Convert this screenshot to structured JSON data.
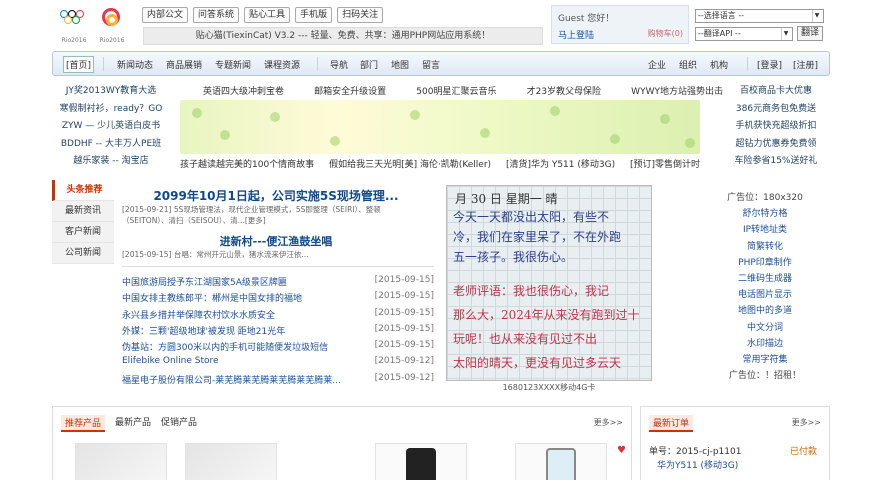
{
  "logos": [
    {
      "caption": "Rio2016"
    },
    {
      "caption": "Rio2016"
    }
  ],
  "top_buttons": [
    "内部公文",
    "问答系统",
    "贴心工具",
    "手机版",
    "扫码关注"
  ],
  "slogan": "贴心猫(TiexinCat) V3.2 --- 轻量、免费、共享：通用PHP网站应用系统！",
  "user": {
    "greeting": "Guest 您好！",
    "login": "马上登陆",
    "cart": "购物车(0)"
  },
  "language_select": "--选择语言 --",
  "translate_select": "--翻译API --",
  "translate_button": "翻译",
  "nav": {
    "home": "[首页]",
    "left": [
      "新闻动态",
      "商品展销",
      "专题新闻",
      "课程资源"
    ],
    "mid": [
      "导航",
      "部门",
      "地图",
      "留言"
    ],
    "right": [
      "企业",
      "组织",
      "机构"
    ],
    "auth": [
      "[登录]",
      "[注册]"
    ]
  },
  "ads_left": [
    "JY奖2013WY教育大选",
    "寒假制衬衫，ready？GO",
    "ZYW — 少儿英语白皮书",
    "BDDHF -- 大丰万人PE班",
    "越乐家装 -- 淘宝店"
  ],
  "ads_top": [
    "英语四大级冲刺宝卷",
    "邮箱安全升级设置",
    "500明星汇聚云音乐",
    "才23岁教父母保险",
    "WYWY地方站强势出击"
  ],
  "ads_bottom": [
    "孩子越读越完美的100个情商故事",
    "假如给我三天光明[美] 海伦·凯勒(Keller)",
    "[清货]华为 Y511 (移动3G)",
    "[预订]零售倒计时"
  ],
  "ads_right": [
    "百校商品卡大优惠",
    "386元商务包免费送",
    "手机获快充超级折扣",
    "超钻力优惠券免费领",
    "车险参省15%送好礼"
  ],
  "left_menu": [
    "头条推荐",
    "最新资讯",
    "客户新闻",
    "公司新闻"
  ],
  "headline": {
    "title": "2099年10月1日起，公司实施5S现场管理...",
    "desc": "[2015-09-21] 5S现场管理法，现代企业管理模式，5S即整理（SEIRI）、整顿（SEITON）、清扫（SEISOU）、清...[更多]",
    "title2": "进新村---便江渔鼓坐唱",
    "desc2": "[2015-09-15] 台唱：常州开元山景，猪水流来伊汪依..."
  },
  "news": [
    {
      "title": "中国旅游局授予东江湖国家5A级景区牌匾",
      "date": "[2015-09-15]"
    },
    {
      "title": "中国女排主教练郎平：郴州是中国女排的福地",
      "date": "[2015-09-15]"
    },
    {
      "title": "永兴县乡措并举保障农村饮水水质安全",
      "date": "[2015-09-15]"
    },
    {
      "title": "外媒：三颗'超级地球'被发现 距地21光年",
      "date": "[2015-09-15]"
    },
    {
      "title": "伪基站：方圆300米以内的手机可能随便发垃圾短信",
      "date": "[2015-09-15]"
    },
    {
      "title": "Elifebike Online Store",
      "date": "[2015-09-12]"
    },
    {
      "title": "福星电子股份有限公司-莱芜腾莱芜腾莱芜腾莱芜腾莱...",
      "date": "[2015-09-12]"
    }
  ],
  "photo_caption": "1680123XXXX移动4G卡",
  "photo_lines": [
    "月 30 日   星期一   晴",
    "今天一天都没出太阳，有些不",
    "冷，我们在家里呆了，不在外跑",
    "五一孩子。我很伤心。",
    "老师评语：我也很伤心，我记",
    "那么大，2024年从来没有跑到过十",
    "玩呢！也从来没有见过不出",
    "太阳的晴天，更没有见过多云天"
  ],
  "right_tools": [
    "广告位：180x320",
    "舒尔特方格",
    "IP转地址类",
    "简繁转化",
    "PHP印章制作",
    "二维码生成器",
    "电话图片显示",
    "地图中的多道",
    "中文分词",
    "水印描边",
    "常用字符集",
    "广告位：！招租！"
  ],
  "bottom_left": {
    "tabs": [
      "推荐产品",
      "最新产品",
      "促销产品"
    ],
    "more": "更多>>"
  },
  "bottom_right": {
    "tab": "最新订单",
    "more": "更多>>",
    "order_no": "单号：2015-cj-p1101",
    "order_status": "已付款",
    "order_item": "华为Y511 (移动3G)"
  },
  "colors": {
    "accent": "#cc3300",
    "link": "#1c4f9a",
    "nav_bg": "#dfe9f4"
  }
}
